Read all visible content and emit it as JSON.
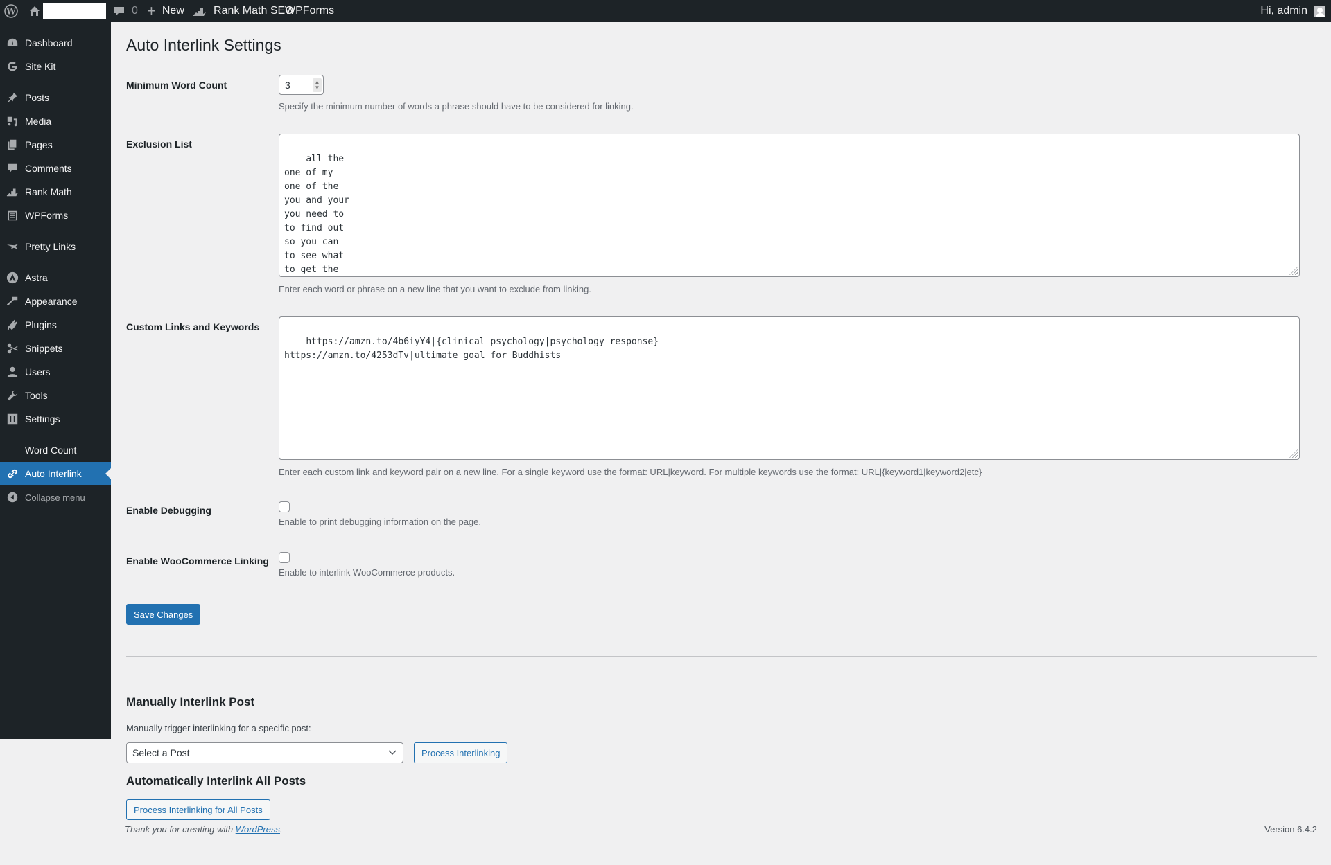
{
  "adminbar": {
    "comments_count": "0",
    "new_label": "New",
    "rankmath_label": "Rank Math SEO",
    "wpforms_label": "WPForms",
    "greeting": "Hi, admin"
  },
  "sidebar": {
    "items": [
      {
        "label": "Dashboard",
        "icon": "dashboard-icon"
      },
      {
        "label": "Site Kit",
        "icon": "google-g-icon"
      },
      {
        "label": "Posts",
        "icon": "pushpin-icon"
      },
      {
        "label": "Media",
        "icon": "media-icon"
      },
      {
        "label": "Pages",
        "icon": "pages-icon"
      },
      {
        "label": "Comments",
        "icon": "comment-icon"
      },
      {
        "label": "Rank Math",
        "icon": "rank-math-icon"
      },
      {
        "label": "WPForms",
        "icon": "wpforms-icon"
      },
      {
        "label": "Pretty Links",
        "icon": "pretty-links-icon"
      },
      {
        "label": "Astra",
        "icon": "astra-icon"
      },
      {
        "label": "Appearance",
        "icon": "paintbrush-icon"
      },
      {
        "label": "Plugins",
        "icon": "plug-icon"
      },
      {
        "label": "Snippets",
        "icon": "scissors-icon"
      },
      {
        "label": "Users",
        "icon": "user-icon"
      },
      {
        "label": "Tools",
        "icon": "wrench-icon"
      },
      {
        "label": "Settings",
        "icon": "sliders-icon"
      },
      {
        "label": "Word Count",
        "icon": ""
      },
      {
        "label": "Auto Interlink",
        "icon": "link-icon"
      },
      {
        "label": "Collapse menu",
        "icon": "collapse-icon"
      }
    ],
    "current": "Auto Interlink",
    "accent_color": "#2271b1"
  },
  "page": {
    "title": "Auto Interlink Settings",
    "min_word_count": {
      "label": "Minimum Word Count",
      "value": "3",
      "description": "Specify the minimum number of words a phrase should have to be considered for linking."
    },
    "exclusion_list": {
      "label": "Exclusion List",
      "value": "all the\none of my\none of the\nyou and your\nyou need to\nto find out\nso you can\nto see what\nto get the\nto help you",
      "description": "Enter each word or phrase on a new line that you want to exclude from linking."
    },
    "custom_links": {
      "label": "Custom Links and Keywords",
      "value": "https://amzn.to/4b6iyY4|{clinical psychology|psychology response}\nhttps://amzn.to/4253dTv|ultimate goal for Buddhists",
      "description": "Enter each custom link and keyword pair on a new line. For a single keyword use the format: URL|keyword. For multiple keywords use the format: URL|{keyword1|keyword2|etc}"
    },
    "debugging": {
      "label": "Enable Debugging",
      "checked": false,
      "description": "Enable to print debugging information on the page."
    },
    "woocommerce": {
      "label": "Enable WooCommerce Linking",
      "checked": false,
      "description": "Enable to interlink WooCommerce products."
    },
    "save_label": "Save Changes",
    "manual": {
      "heading": "Manually Interlink Post",
      "description": "Manually trigger interlinking for a specific post:",
      "select_value": "Select a Post",
      "button_label": "Process Interlinking"
    },
    "auto": {
      "heading": "Automatically Interlink All Posts",
      "button_label": "Process Interlinking for All Posts"
    }
  },
  "footer": {
    "thanks_prefix": "Thank you for creating with ",
    "thanks_link": "WordPress",
    "thanks_suffix": ".",
    "version": "Version 6.4.2"
  }
}
